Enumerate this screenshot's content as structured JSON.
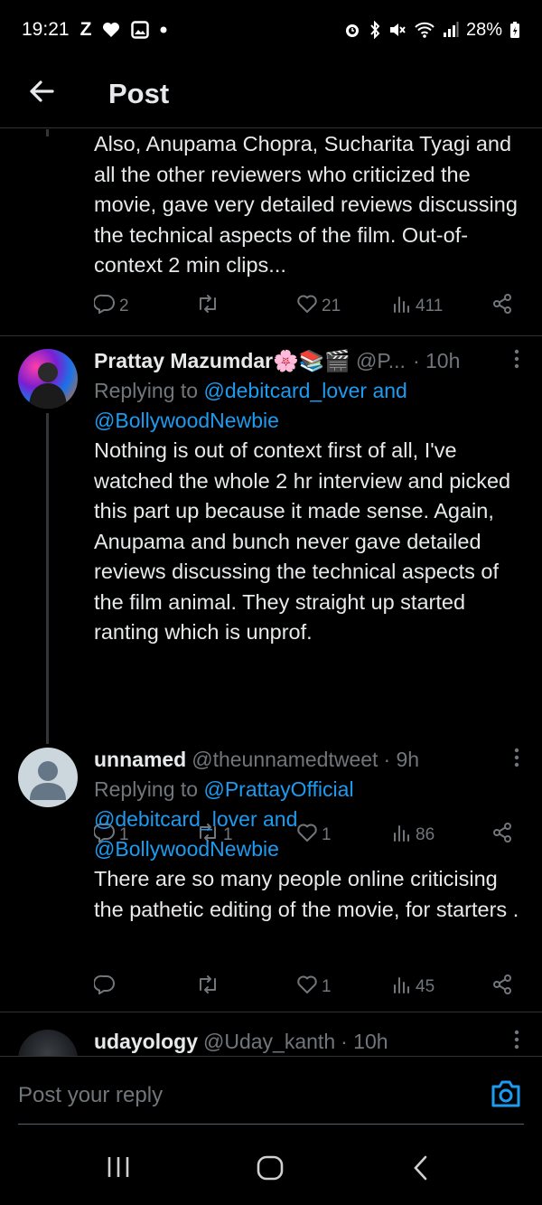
{
  "status_bar": {
    "time": "19:21",
    "carrier_letter": "Z",
    "battery": "28%",
    "icons": [
      "heart-icon",
      "gallery-icon",
      "dot-icon",
      "alarm-icon",
      "bluetooth-icon",
      "mute-icon",
      "wifi-icon",
      "signal-icon",
      "battery-icon"
    ]
  },
  "header": {
    "title": "Post"
  },
  "posts": [
    {
      "text": "Also, Anupama Chopra, Sucharita Tyagi and all the other reviewers who criticized the movie, gave very detailed reviews discussing the technical aspects of the film. Out-of-context 2 min clips...",
      "replies": "2",
      "reposts": "",
      "likes": "21",
      "views": "411"
    },
    {
      "name": "Prattay Mazumdar🌸📚🎬",
      "handle": "@P...",
      "time": "· 10h",
      "replying_prefix": "Replying to ",
      "replying_to_1": "@debitcard_lover and",
      "replying_to_2": "@BollywoodNewbie",
      "text": "Nothing is out of context first of all, I've watched the whole 2 hr interview and picked this part up because it made sense. Again, Anupama and bunch never gave detailed reviews discussing the technical aspects of the film animal. They straight up started ranting which is unprof.",
      "replies": "1",
      "reposts": "1",
      "likes": "1",
      "views": "86"
    },
    {
      "name": "unnamed",
      "handle": "@theunnamedtweet",
      "time": "· 9h",
      "replying_prefix": "Replying to ",
      "replying_to_1": "@PrattayOfficial",
      "replying_to_2": "@debitcard_lover and",
      "replying_to_3": "@BollywoodNewbie",
      "text": "There are so many people online criticising the pathetic editing of the movie, for starters .",
      "replies": "",
      "reposts": "",
      "likes": "1",
      "views": "45"
    },
    {
      "name": "udayology",
      "handle": "@Uday_kanth",
      "time": "· 10h"
    }
  ],
  "reply_bar": {
    "placeholder": "Post your reply"
  },
  "colors": {
    "background": "#000000",
    "text": "#e7e9ea",
    "muted": "#71767b",
    "link": "#1d9bf0",
    "divider": "#2f3336"
  }
}
